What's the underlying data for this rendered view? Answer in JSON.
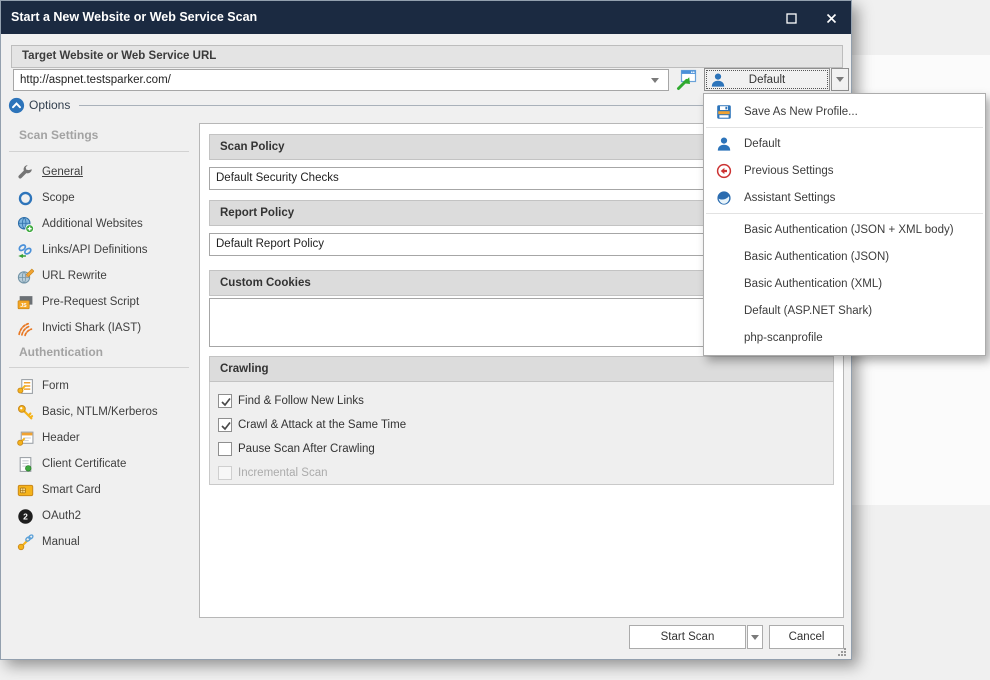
{
  "window": {
    "title": "Start a New Website or Web Service Scan"
  },
  "target": {
    "header": "Target Website or Web Service URL",
    "url": "http://aspnet.testsparker.com/"
  },
  "profile_button": {
    "label": "Default"
  },
  "options": {
    "label": "Options"
  },
  "sidebar": {
    "scan_header": "Scan Settings",
    "scan_items": [
      {
        "icon": "wrench-icon",
        "label": "General",
        "selected": true
      },
      {
        "icon": "scope-icon",
        "label": "Scope"
      },
      {
        "icon": "globe-plus-icon",
        "label": "Additional Websites"
      },
      {
        "icon": "links-icon",
        "label": "Links/API Definitions"
      },
      {
        "icon": "globe-pencil-icon",
        "label": "URL Rewrite"
      },
      {
        "icon": "script-icon",
        "label": "Pre-Request Script"
      },
      {
        "icon": "shark-waves-icon",
        "label": "Invicti Shark (IAST)"
      }
    ],
    "auth_header": "Authentication",
    "auth_items": [
      {
        "icon": "form-key-icon",
        "label": "Form"
      },
      {
        "icon": "key-icon",
        "label": "Basic, NTLM/Kerberos"
      },
      {
        "icon": "header-key-icon",
        "label": "Header"
      },
      {
        "icon": "certificate-icon",
        "label": "Client Certificate"
      },
      {
        "icon": "smartcard-icon",
        "label": "Smart Card"
      },
      {
        "icon": "oauth2-icon",
        "label": "OAuth2"
      },
      {
        "icon": "manual-key-icon",
        "label": "Manual"
      }
    ]
  },
  "main": {
    "scan_policy": {
      "header": "Scan Policy",
      "value": "Default Security Checks"
    },
    "report_policy": {
      "header": "Report Policy",
      "value": "Default Report Policy"
    },
    "custom_cookies": {
      "header": "Custom Cookies",
      "value": ""
    },
    "crawling": {
      "header": "Crawling",
      "checkboxes": [
        {
          "label": "Find & Follow New Links",
          "checked": true,
          "disabled": false
        },
        {
          "label": "Crawl & Attack at the Same Time",
          "checked": true,
          "disabled": false
        },
        {
          "label": "Pause Scan After Crawling",
          "checked": false,
          "disabled": false
        },
        {
          "label": "Incremental Scan",
          "checked": false,
          "disabled": true
        }
      ]
    }
  },
  "menu": {
    "items": [
      {
        "icon": "save-icon",
        "label": "Save As New Profile..."
      },
      {
        "icon": "user-icon",
        "label": "Default"
      },
      {
        "icon": "back-icon",
        "label": "Previous Settings"
      },
      {
        "icon": "assistant-icon",
        "label": "Assistant Settings"
      },
      {
        "icon": "",
        "label": "Basic Authentication (JSON + XML body)"
      },
      {
        "icon": "",
        "label": "Basic Authentication (JSON)"
      },
      {
        "icon": "",
        "label": "Basic Authentication (XML)"
      },
      {
        "icon": "",
        "label": "Default (ASP.NET Shark)"
      },
      {
        "icon": "",
        "label": "php-scanprofile"
      }
    ]
  },
  "footer": {
    "start_scan": "Start Scan",
    "cancel": "Cancel"
  },
  "colors": {
    "titlebar": "#1b2a41",
    "accent_blue": "#2d74ba",
    "orange": "#f0a232",
    "green": "#3faa3f",
    "red": "#cc3333"
  }
}
